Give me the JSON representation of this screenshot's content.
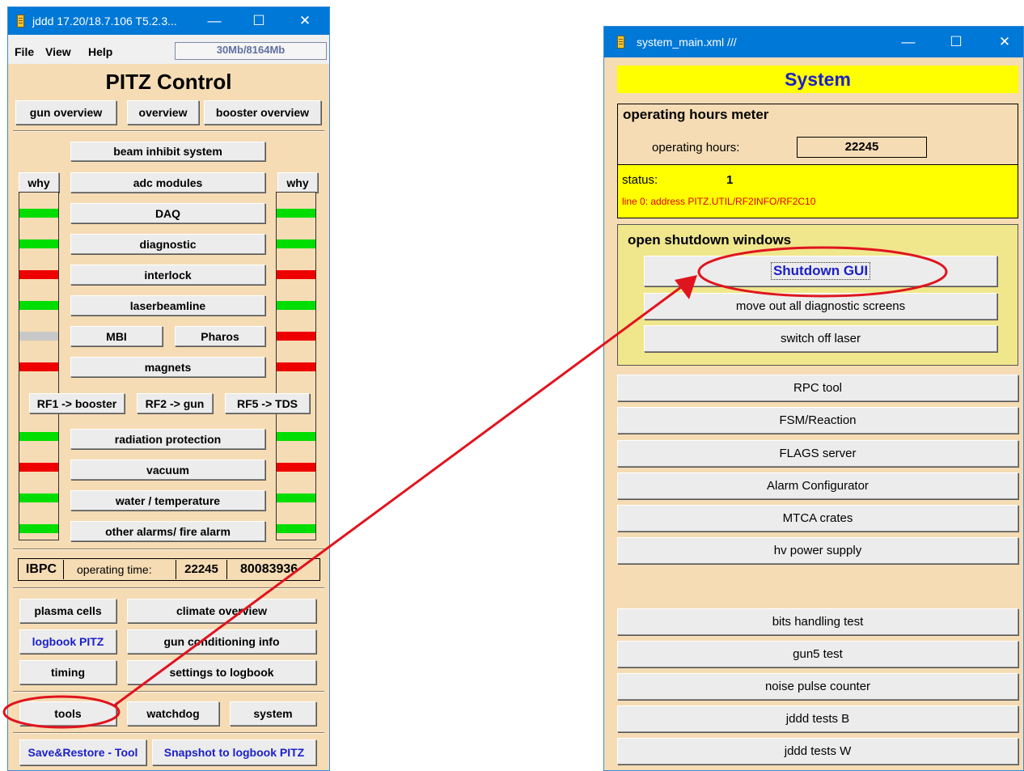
{
  "left_window": {
    "title": "jddd 17.20/18.7.106 T5.2.3...",
    "menu": [
      "File",
      "View",
      "Help"
    ],
    "memory": "30Mb/8164Mb",
    "heading": "PITZ Control",
    "top_buttons": [
      "gun overview",
      "overview",
      "booster overview"
    ],
    "beam_inhibit": "beam inhibit system",
    "why_label": "why",
    "status_buttons": [
      "adc modules",
      "DAQ",
      "diagnostic",
      "interlock",
      "laserbeamline"
    ],
    "mbi": "MBI",
    "pharos": "Pharos",
    "magnets": "magnets",
    "rf_buttons": [
      "RF1 -> booster",
      "RF2 -> gun",
      "RF5 -> TDS"
    ],
    "lower_buttons": [
      "radiation protection",
      "vacuum",
      "water / temperature",
      "other alarms/ fire alarm"
    ],
    "ibpc": "IBPC",
    "operating_time_label": "operating time:",
    "operating_time_value": "22245",
    "counter_value": "80083936",
    "grid_buttons": [
      "plasma cells",
      "climate overview",
      "logbook PITZ",
      "gun conditioning info",
      "timing",
      "settings to logbook"
    ],
    "tool_buttons": [
      "tools",
      "watchdog",
      "system"
    ],
    "save_restore": "Save&Restore - Tool",
    "snapshot": "Snapshot to logbook PITZ",
    "left_bar_colors": [
      "#00dd00",
      "#00dd00",
      "#ee0000",
      "#00dd00",
      "#c8c8c8",
      "#ee0000",
      "#00dd00",
      "#ee0000",
      "#00dd00",
      "#00dd00"
    ],
    "right_bar_colors": [
      "#00dd00",
      "#00dd00",
      "#ee0000",
      "#00dd00",
      "#ee0000",
      "#ee0000",
      "#00dd00",
      "#ee0000",
      "#00dd00",
      "#00dd00"
    ]
  },
  "right_window": {
    "title": "system_main.xml  ///",
    "heading": "System",
    "meter_title": "operating hours meter",
    "operating_hours_label": "operating hours:",
    "operating_hours_value": "22245",
    "status_label": "status:",
    "status_value": "1",
    "status_message": "line 0: address PITZ.UTIL/RF2INFO/RF2C10",
    "shutdown_title": "open shutdown windows",
    "shutdown_buttons": [
      "Shutdown GUI",
      "move out all diagnostic screens",
      "switch off laser"
    ],
    "tools": [
      "RPC tool",
      "FSM/Reaction",
      "FLAGS server",
      "Alarm Configurator",
      "MTCA crates",
      "hv power supply"
    ],
    "tests": [
      "bits handling test",
      "gun5 test",
      "noise pulse counter",
      "jddd tests B",
      "jddd tests W"
    ]
  },
  "colors": {
    "titlebar": "#0078d7",
    "panel": "#f5dcb4",
    "highlight_yellow": "#ffff00",
    "annotation_red": "#e0141e",
    "link_blue": "#1c20c8"
  }
}
